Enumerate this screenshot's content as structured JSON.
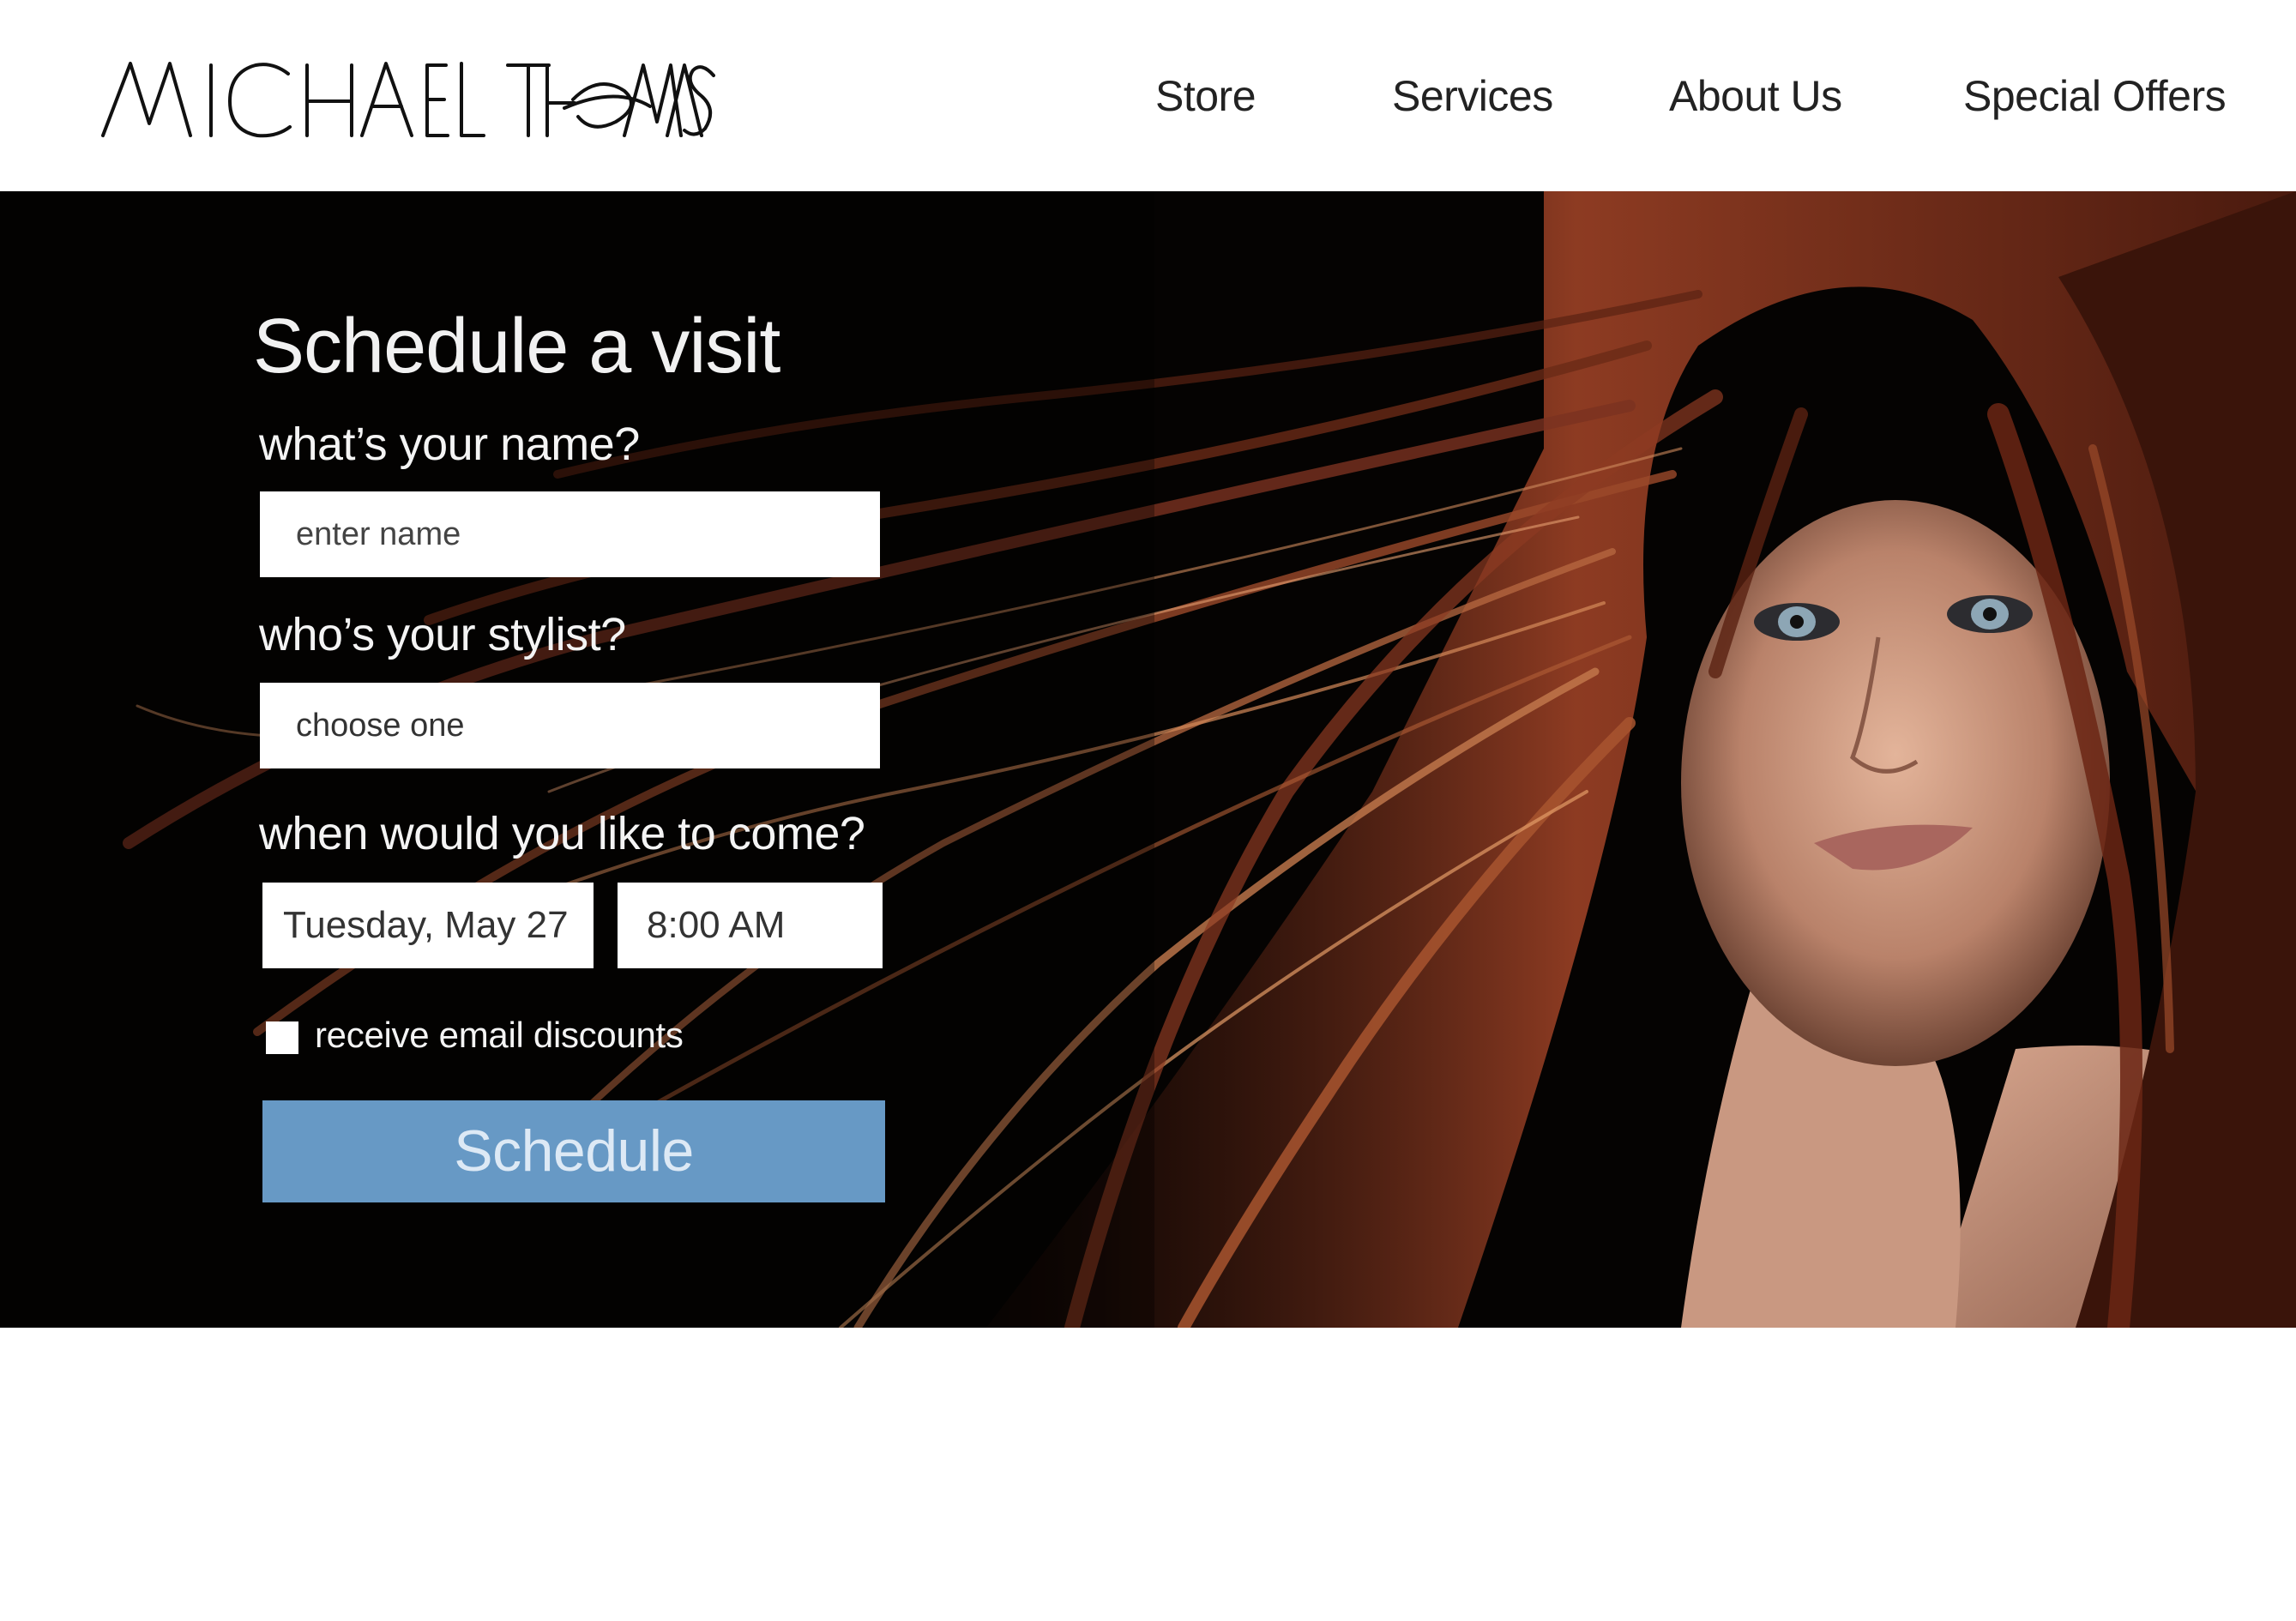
{
  "brand": {
    "logo_text": "MICHAEL THOMAS"
  },
  "nav": {
    "items": [
      {
        "label": "Store"
      },
      {
        "label": "Services"
      },
      {
        "label": "About Us"
      },
      {
        "label": "Special Offers"
      }
    ]
  },
  "form": {
    "title": "Schedule a visit",
    "name_label": "what’s your name?",
    "name_placeholder": "enter name",
    "name_value": "",
    "stylist_label": "who’s your stylist?",
    "stylist_value": "choose one",
    "when_label": "when would you like to come?",
    "date_value": "Tuesday, May 27",
    "time_value": "8:00 AM",
    "email_discounts_label": "receive email discounts",
    "email_discounts_checked": false,
    "submit_label": "Schedule"
  },
  "colors": {
    "button_bg": "#6799c5",
    "hero_bg": "#050302",
    "hair": "#8a3a22"
  }
}
